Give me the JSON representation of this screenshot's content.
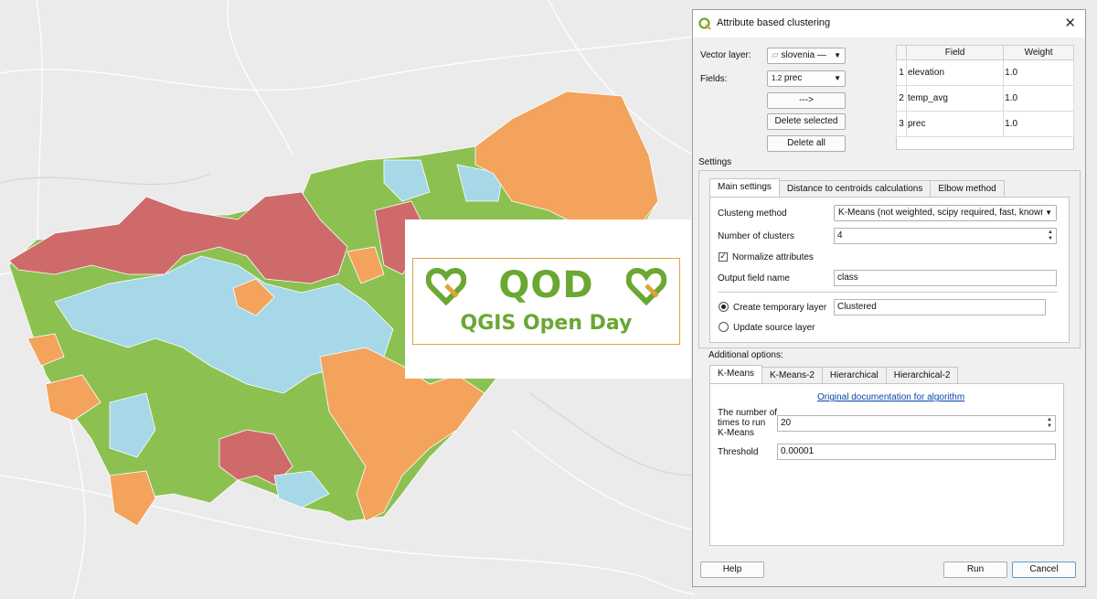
{
  "logo": {
    "main_text": "QOD",
    "sub_text": "QGIS Open Day"
  },
  "dialog": {
    "title": "Attribute based clustering",
    "close": "✕",
    "vector_layer_label": "Vector layer:",
    "vector_layer_value": "slovenia —",
    "fields_label": "Fields:",
    "fields_value_prefix": "1.2",
    "fields_value": "prec",
    "add_button": "--->",
    "delete_selected_button": "Delete selected",
    "delete_all_button": "Delete all",
    "table": {
      "headers": [
        "Field",
        "Weight"
      ],
      "rows": [
        {
          "index": "1",
          "field": "elevation",
          "weight": "1.0"
        },
        {
          "index": "2",
          "field": "temp_avg",
          "weight": "1.0"
        },
        {
          "index": "3",
          "field": "prec",
          "weight": "1.0"
        }
      ]
    },
    "settings_label": "Settings",
    "settings_tabs": [
      "Main settings",
      "Distance to centroids calculations",
      "Elbow method"
    ],
    "main": {
      "method_label": "Clusteng method",
      "method_value": "K-Means (not weighted, scipy required, fast, known",
      "clusters_label": "Number of clusters",
      "clusters_value": "4",
      "normalize_label": "Normalize attributes",
      "normalize_checked": true,
      "output_label": "Output field name",
      "output_value": "class",
      "create_temp_label": "Create temporary layer",
      "temp_layer_value": "Clustered",
      "update_source_label": "Update source layer"
    },
    "additional_label": "Additional options:",
    "algo_tabs": [
      "K-Means",
      "K-Means-2",
      "Hierarchical",
      "Hierarchical-2"
    ],
    "algo": {
      "doc_link": "Original documentation for algorithm",
      "runs_label_1": "The number of",
      "runs_label_2": "times to run",
      "runs_label_3": "K-Means",
      "runs_value": "20",
      "threshold_label": "Threshold",
      "threshold_value": "0.00001"
    },
    "help_button": "Help",
    "run_button": "Run",
    "cancel_button": "Cancel"
  },
  "colors": {
    "cluster_red": "#cf6a6a",
    "cluster_green": "#8cc152",
    "cluster_blue": "#a6d8e8",
    "cluster_orange": "#f3a35c",
    "brand_green": "#6aa733"
  }
}
